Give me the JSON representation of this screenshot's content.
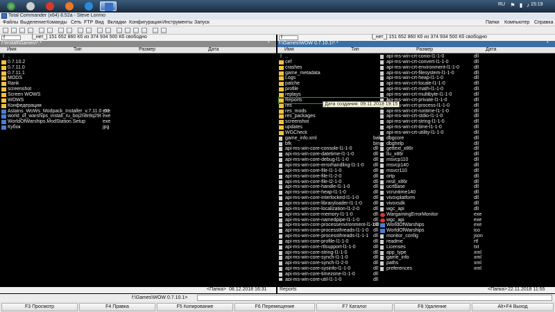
{
  "taskbar": {
    "lang": "RU",
    "time": "15:19"
  },
  "window": {
    "title": "Total Commander (x64) 8.52a - Steve Lonmo"
  },
  "menu": {
    "left": [
      "Файлы",
      "Выделение",
      "Команды",
      "Сеть",
      "FTP",
      "Вид",
      "Вкладки",
      "Конфигурация",
      "Инструменты",
      "Запуск"
    ],
    "right": [
      "Папки",
      "Компьютер",
      "Справка"
    ]
  },
  "drives": {
    "left": {
      "letter": "f",
      "info": "[_нет_]  151 652 860 Кб из 374 934 500 Кб свободно"
    },
    "right": {
      "letter": "f",
      "info": "[_нет_]  151 652 860 Кб из 374 934 500 Кб свободно"
    }
  },
  "left_panel": {
    "path": "f:\\Install\\Games\\*.*",
    "star": "*",
    "columns": {
      "name": "Имя",
      "type": "Тип",
      "size": "Размер",
      "date": "Дата"
    },
    "rows": [
      {
        "name": "..",
        "ext": "",
        "kind": "up"
      },
      {
        "name": "0.7.10.2",
        "ext": "",
        "kind": "folder"
      },
      {
        "name": "0.7.11.0",
        "ext": "",
        "kind": "folder"
      },
      {
        "name": "0.7.11.1",
        "ext": "",
        "kind": "folder"
      },
      {
        "name": "MODS",
        "ext": "",
        "kind": "folder"
      },
      {
        "name": "Rank",
        "ext": "",
        "kind": "folder"
      },
      {
        "name": "screenshot",
        "ext": "",
        "kind": "folder"
      },
      {
        "name": "Screen WOWS",
        "ext": "",
        "kind": "folder"
      },
      {
        "name": "WOWS",
        "ext": "",
        "kind": "folder"
      },
      {
        "name": "Конфедерация",
        "ext": "",
        "kind": "folder"
      },
      {
        "name": "Aslains_WoWs_Modpack_Installer_v.7.11.0_01",
        "ext": "exe",
        "kind": "exe"
      },
      {
        "name": "world_of_warships_install_ru_boj2n8r8q29t",
        "ext": "exe",
        "kind": "exe"
      },
      {
        "name": "WorldOfWarships.ModStation.Setup",
        "ext": "exe",
        "kind": "exe"
      },
      {
        "name": "Кубок",
        "ext": "jpg",
        "kind": "image"
      }
    ],
    "status_left": "<Папка>",
    "status_right": "08.12.2018 16:31"
  },
  "right_panel": {
    "path": "f:\\Games\\WOW 0.7.10.1\\*.*",
    "star": "*",
    "columns": {
      "name": "Имя",
      "type": "Тип",
      "size": "Размер",
      "date": "Дата"
    },
    "col1": [
      {
        "name": "..",
        "ext": "",
        "kind": "up"
      },
      {
        "name": "cef",
        "ext": "",
        "kind": "folder"
      },
      {
        "name": "crashes",
        "ext": "",
        "kind": "folder"
      },
      {
        "name": "game_metadata",
        "ext": "",
        "kind": "folder"
      },
      {
        "name": "Logs",
        "ext": "",
        "kind": "folder"
      },
      {
        "name": "patche",
        "ext": "",
        "kind": "folder"
      },
      {
        "name": "profile",
        "ext": "",
        "kind": "folder"
      },
      {
        "name": "replays",
        "ext": "",
        "kind": "folder"
      },
      {
        "name": "Reports",
        "ext": "",
        "kind": "folder",
        "selected": true
      },
      {
        "name": "res",
        "ext": "",
        "kind": "folder"
      },
      {
        "name": "res_mods",
        "ext": "",
        "kind": "folder"
      },
      {
        "name": "res_packages",
        "ext": "",
        "kind": "folder"
      },
      {
        "name": "screenshot",
        "ext": "",
        "kind": "folder"
      },
      {
        "name": "updates",
        "ext": "",
        "kind": "folder"
      },
      {
        "name": "WGCheck",
        "ext": "",
        "kind": "folder"
      },
      {
        "name": "game_info.xml",
        "ext": "bak",
        "kind": "file"
      },
      {
        "name": "bfk",
        "ext": "bin",
        "kind": "file"
      },
      {
        "name": "api-ms-win-core-console-l1-1-0",
        "ext": "dll",
        "kind": "file"
      },
      {
        "name": "api-ms-win-core-datetime-l1-1-0",
        "ext": "dll",
        "kind": "file"
      },
      {
        "name": "api-ms-win-core-debug-l1-1-0",
        "ext": "dll",
        "kind": "file"
      },
      {
        "name": "api-ms-win-core-errorhandling-l1-1-0",
        "ext": "dll",
        "kind": "file"
      },
      {
        "name": "api-ms-win-core-file-l1-1-0",
        "ext": "dll",
        "kind": "file"
      },
      {
        "name": "api-ms-win-core-file-l1-2-0",
        "ext": "dll",
        "kind": "file"
      },
      {
        "name": "api-ms-win-core-file-l2-1-0",
        "ext": "dll",
        "kind": "file"
      },
      {
        "name": "api-ms-win-core-handle-l1-1-0",
        "ext": "dll",
        "kind": "file"
      },
      {
        "name": "api-ms-win-core-heap-l1-1-0",
        "ext": "dll",
        "kind": "file"
      },
      {
        "name": "api-ms-win-core-interlocked-l1-1-0",
        "ext": "dll",
        "kind": "file"
      },
      {
        "name": "api-ms-win-core-libraryloader-l1-1-0",
        "ext": "dll",
        "kind": "file"
      },
      {
        "name": "api-ms-win-core-localization-l1-2-0",
        "ext": "dll",
        "kind": "file"
      },
      {
        "name": "api-ms-win-core-memory-l1-1-0",
        "ext": "dll",
        "kind": "file"
      },
      {
        "name": "api-ms-win-core-namedpipe-l1-1-0",
        "ext": "dll",
        "kind": "file"
      },
      {
        "name": "api-ms-win-core-processenvironment-l1-1-0",
        "ext": "dll",
        "kind": "file"
      },
      {
        "name": "api-ms-win-core-processthreads-l1-1-0",
        "ext": "dll",
        "kind": "file"
      },
      {
        "name": "api-ms-win-core-processthreads-l1-1-1",
        "ext": "dll",
        "kind": "file"
      },
      {
        "name": "api-ms-win-core-profile-l1-1-0",
        "ext": "dll",
        "kind": "file"
      },
      {
        "name": "api-ms-win-core-rtlsupport-l1-1-0",
        "ext": "dll",
        "kind": "file"
      },
      {
        "name": "api-ms-win-core-string-l1-1-0",
        "ext": "dll",
        "kind": "file"
      },
      {
        "name": "api-ms-win-core-synch-l1-1-0",
        "ext": "dll",
        "kind": "file"
      },
      {
        "name": "api-ms-win-core-synch-l1-2-0",
        "ext": "dll",
        "kind": "file"
      },
      {
        "name": "api-ms-win-core-sysinfo-l1-1-0",
        "ext": "dll",
        "kind": "file"
      },
      {
        "name": "api-ms-win-core-timezone-l1-1-0",
        "ext": "dll",
        "kind": "file"
      },
      {
        "name": "api-ms-win-core-util-l1-1-0",
        "ext": "dll",
        "kind": "file"
      }
    ],
    "col2": [
      {
        "name": "api-ms-win-crt-conio-l1-1-0",
        "ext": "dll",
        "kind": "file"
      },
      {
        "name": "api-ms-win-crt-convert-l1-1-0",
        "ext": "dll",
        "kind": "file"
      },
      {
        "name": "api-ms-win-crt-environment-l1-1-0",
        "ext": "dll",
        "kind": "file"
      },
      {
        "name": "api-ms-win-crt-filesystem-l1-1-0",
        "ext": "dll",
        "kind": "file"
      },
      {
        "name": "api-ms-win-crt-heap-l1-1-0",
        "ext": "dll",
        "kind": "file"
      },
      {
        "name": "api-ms-win-crt-locale-l1-1-0",
        "ext": "dll",
        "kind": "file"
      },
      {
        "name": "api-ms-win-crt-math-l1-1-0",
        "ext": "dll",
        "kind": "file"
      },
      {
        "name": "api-ms-win-crt-multibyte-l1-1-0",
        "ext": "dll",
        "kind": "file"
      },
      {
        "name": "api-ms-win-crt-private-l1-1-0",
        "ext": "dll",
        "kind": "file"
      },
      {
        "name": "api-ms-win-crt-process-l1-1-0",
        "ext": "dll",
        "kind": "file"
      },
      {
        "name": "api-ms-win-crt-runtime-l1-1-0",
        "ext": "dll",
        "kind": "file"
      },
      {
        "name": "api-ms-win-crt-stdio-l1-1-0",
        "ext": "dll",
        "kind": "file"
      },
      {
        "name": "api-ms-win-crt-string-l1-1-0",
        "ext": "dll",
        "kind": "file"
      },
      {
        "name": "api-ms-win-crt-time-l1-1-0",
        "ext": "dll",
        "kind": "file"
      },
      {
        "name": "api-ms-win-crt-utility-l1-1-0",
        "ext": "dll",
        "kind": "file"
      },
      {
        "name": "dbgcore",
        "ext": "dll",
        "kind": "file"
      },
      {
        "name": "dbghelp",
        "ext": "dll",
        "kind": "file"
      },
      {
        "name": "gettext_x86r",
        "ext": "dll",
        "kind": "file"
      },
      {
        "name": "llu_x86r",
        "ext": "dll",
        "kind": "file"
      },
      {
        "name": "msvcp110",
        "ext": "dll",
        "kind": "file"
      },
      {
        "name": "msvcp140",
        "ext": "dll",
        "kind": "file"
      },
      {
        "name": "msvcr110",
        "ext": "dll",
        "kind": "file"
      },
      {
        "name": "ortp",
        "ext": "dll",
        "kind": "file"
      },
      {
        "name": "resil_x86r",
        "ext": "dll",
        "kind": "file"
      },
      {
        "name": "ucrtbase",
        "ext": "dll",
        "kind": "file"
      },
      {
        "name": "vcruntime140",
        "ext": "dll",
        "kind": "file"
      },
      {
        "name": "vivoxplatform",
        "ext": "dll",
        "kind": "file"
      },
      {
        "name": "vivoxsdk",
        "ext": "dll",
        "kind": "file"
      },
      {
        "name": "wgc_api",
        "ext": "dll",
        "kind": "file"
      },
      {
        "name": "WargamingErrorMonitor",
        "ext": "exe",
        "kind": "red"
      },
      {
        "name": "wgc_api",
        "ext": "exe",
        "kind": "red"
      },
      {
        "name": "WorldOfWarships",
        "ext": "exe",
        "kind": "exe"
      },
      {
        "name": "WorldOfWarships",
        "ext": "ico",
        "kind": "exe"
      },
      {
        "name": "monitor_config",
        "ext": "json",
        "kind": "file"
      },
      {
        "name": "readme",
        "ext": "rtf",
        "kind": "file"
      },
      {
        "name": "Licenses",
        "ext": "txt",
        "kind": "file"
      },
      {
        "name": "app_type",
        "ext": "xml",
        "kind": "file"
      },
      {
        "name": "game_info",
        "ext": "xml",
        "kind": "file"
      },
      {
        "name": "paths",
        "ext": "xml",
        "kind": "file"
      },
      {
        "name": "preferences",
        "ext": "xml",
        "kind": "file"
      }
    ],
    "tooltip": "Дата создания: 09.11.2018 19:15",
    "status_name": "Reports",
    "status_left": "<Папка>",
    "status_right": "22.11.2018 11:55"
  },
  "cmdline": {
    "path": "f:\\Games\\WOW 0.7.10.1>",
    "value": ""
  },
  "fkeys": [
    "F3 Просмотр",
    "F4 Правка",
    "F5 Копирование",
    "F6 Перемещение",
    "F7 Каталог",
    "F8 Удаление",
    "Alt+F4 Выход"
  ]
}
